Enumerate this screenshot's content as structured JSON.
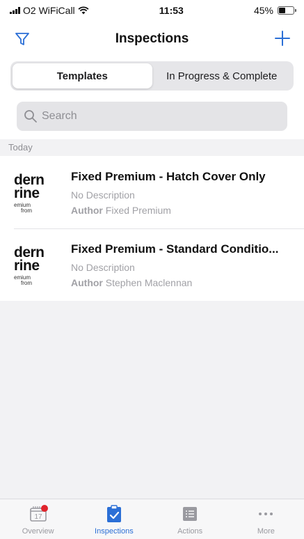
{
  "status": {
    "carrier": "O2 WiFiCall",
    "time": "11:53",
    "battery": "45%",
    "battery_level": 0.45
  },
  "nav": {
    "title": "Inspections",
    "filter_icon": "filter-icon",
    "add_icon": "plus-icon"
  },
  "segments": [
    {
      "label": "Templates",
      "active": true
    },
    {
      "label": "In Progress & Complete",
      "active": false
    }
  ],
  "search": {
    "placeholder": "Search",
    "value": ""
  },
  "section": {
    "header": "Today"
  },
  "templates": [
    {
      "title": "Fixed Premium - Hatch Cover Only",
      "description": "No Description",
      "author_key": "Author",
      "author": "Fixed Premium"
    },
    {
      "title": "Fixed Premium - Standard Conditio...",
      "description": "No Description",
      "author_key": "Author",
      "author": "Stephen Maclennan"
    }
  ],
  "tabs": [
    {
      "label": "Overview",
      "icon": "calendar-icon",
      "calendar_day": "17",
      "active": false
    },
    {
      "label": "Inspections",
      "icon": "clipboard-check-icon",
      "active": true
    },
    {
      "label": "Actions",
      "icon": "list-icon",
      "active": false
    },
    {
      "label": "More",
      "icon": "more-icon",
      "active": false
    }
  ],
  "colors": {
    "accent": "#2b6fd6",
    "badge": "#e0242c",
    "muted": "#a1a1a6"
  }
}
